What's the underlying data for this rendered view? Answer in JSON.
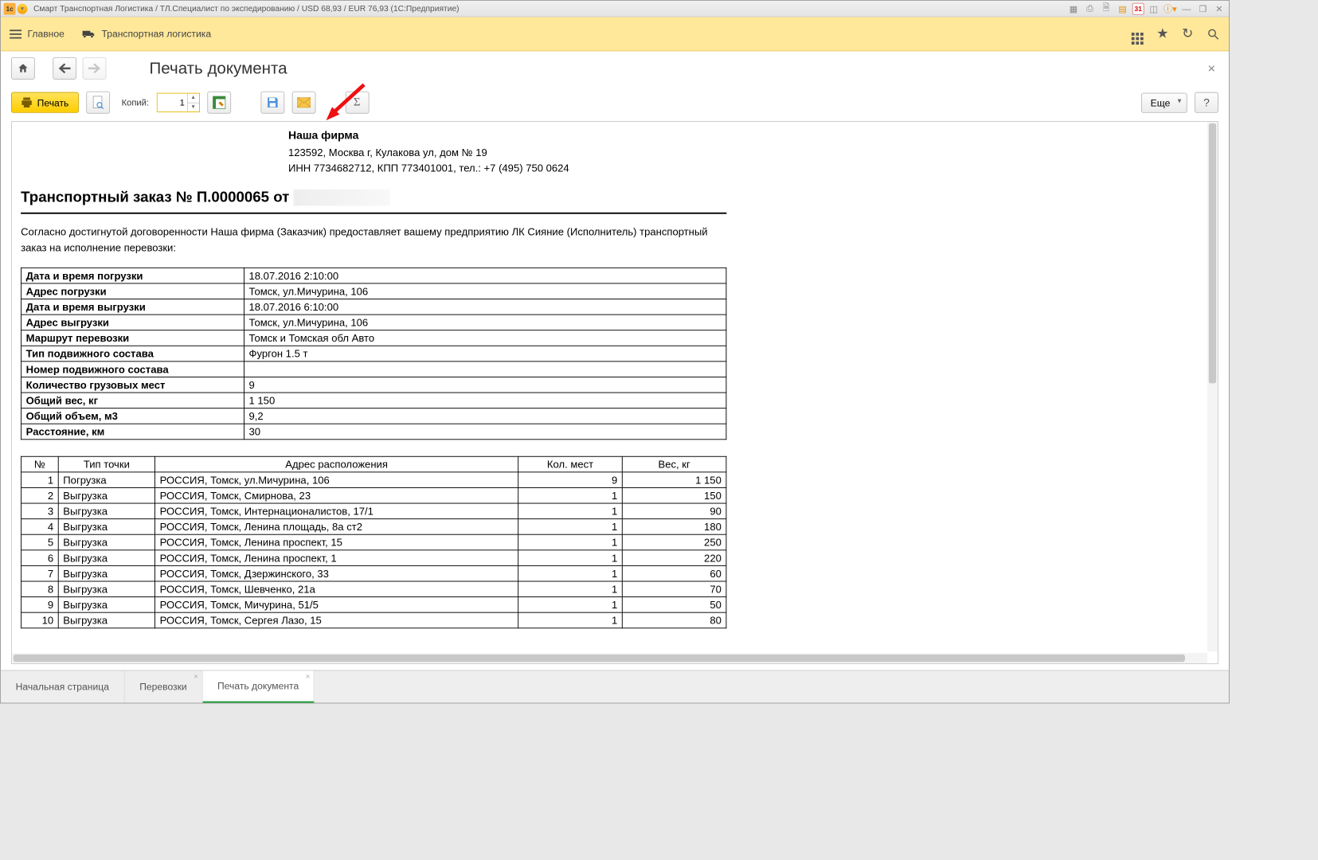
{
  "titlebar": {
    "text": "Смарт Транспортная Логистика / ТЛ.Специалист по экспедированию / USD 68,93 / EUR 76,93  (1С:Предприятие)",
    "calendar_day": "31"
  },
  "mainnav": {
    "home": "Главное",
    "logistics": "Транспортная логистика"
  },
  "page": {
    "title": "Печать документа"
  },
  "toolbar": {
    "print": "Печать",
    "copies_label": "Копий:",
    "copies_value": "1",
    "more": "Еще",
    "help": "?"
  },
  "doc": {
    "firm_name": "Наша фирма",
    "firm_addr": "123592, Москва г, Кулакова ул, дом № 19",
    "firm_ids": "ИНН 7734682712,  КПП 773401001,  тел.: +7 (495) 750 0624",
    "title_prefix": "Транспортный заказ № П.0000065 от",
    "intro": "Согласно достигнутой договоренности Наша фирма (Заказчик) предоставляет вашему предприятию ЛК Сияние (Исполнитель) транспортный заказ на исполнение перевозки:",
    "info": [
      {
        "k": "Дата и время погрузки",
        "v": "18.07.2016 2:10:00"
      },
      {
        "k": "Адрес погрузки",
        "v": "Томск, ул.Мичурина, 106"
      },
      {
        "k": "Дата и время выгрузки",
        "v": "18.07.2016 6:10:00"
      },
      {
        "k": "Адрес выгрузки",
        "v": "Томск, ул.Мичурина, 106"
      },
      {
        "k": "Маршрут перевозки",
        "v": "Томск и Томская обл Авто"
      },
      {
        "k": "Тип подвижного состава",
        "v": "Фургон 1.5 т"
      },
      {
        "k": "Номер подвижного состава",
        "v": ""
      },
      {
        "k": "Количество грузовых мест",
        "v": "9"
      },
      {
        "k": "Общий вес, кг",
        "v": "1 150"
      },
      {
        "k": "Общий объем, м3",
        "v": "9,2"
      },
      {
        "k": "Расстояние, км",
        "v": "30"
      }
    ],
    "pts_hdr": {
      "n": "№",
      "tp": "Тип точки",
      "addr": "Адрес расположения",
      "qty": "Кол. мест",
      "wt": "Вес, кг"
    },
    "pts": [
      {
        "n": "1",
        "tp": "Погрузка",
        "addr": "РОССИЯ, Томск, ул.Мичурина, 106",
        "qty": "9",
        "wt": "1 150"
      },
      {
        "n": "2",
        "tp": "Выгрузка",
        "addr": "РОССИЯ, Томск, Смирнова, 23",
        "qty": "1",
        "wt": "150"
      },
      {
        "n": "3",
        "tp": "Выгрузка",
        "addr": "РОССИЯ, Томск, Интернационалистов, 17/1",
        "qty": "1",
        "wt": "90"
      },
      {
        "n": "4",
        "tp": "Выгрузка",
        "addr": "РОССИЯ, Томск, Ленина площадь, 8а ст2",
        "qty": "1",
        "wt": "180"
      },
      {
        "n": "5",
        "tp": "Выгрузка",
        "addr": "РОССИЯ, Томск, Ленина проспект, 15",
        "qty": "1",
        "wt": "250"
      },
      {
        "n": "6",
        "tp": "Выгрузка",
        "addr": "РОССИЯ, Томск, Ленина проспект, 1",
        "qty": "1",
        "wt": "220"
      },
      {
        "n": "7",
        "tp": "Выгрузка",
        "addr": "РОССИЯ, Томск, Дзержинского, 33",
        "qty": "1",
        "wt": "60"
      },
      {
        "n": "8",
        "tp": "Выгрузка",
        "addr": "РОССИЯ, Томск, Шевченко, 21а",
        "qty": "1",
        "wt": "70"
      },
      {
        "n": "9",
        "tp": "Выгрузка",
        "addr": "РОССИЯ, Томск, Мичурина, 51/5",
        "qty": "1",
        "wt": "50"
      },
      {
        "n": "10",
        "tp": "Выгрузка",
        "addr": "РОССИЯ, Томск, Сергея Лазо, 15",
        "qty": "1",
        "wt": "80"
      }
    ]
  },
  "tabs": {
    "start": "Начальная страница",
    "t1": "Перевозки",
    "t2": "Печать документа"
  }
}
